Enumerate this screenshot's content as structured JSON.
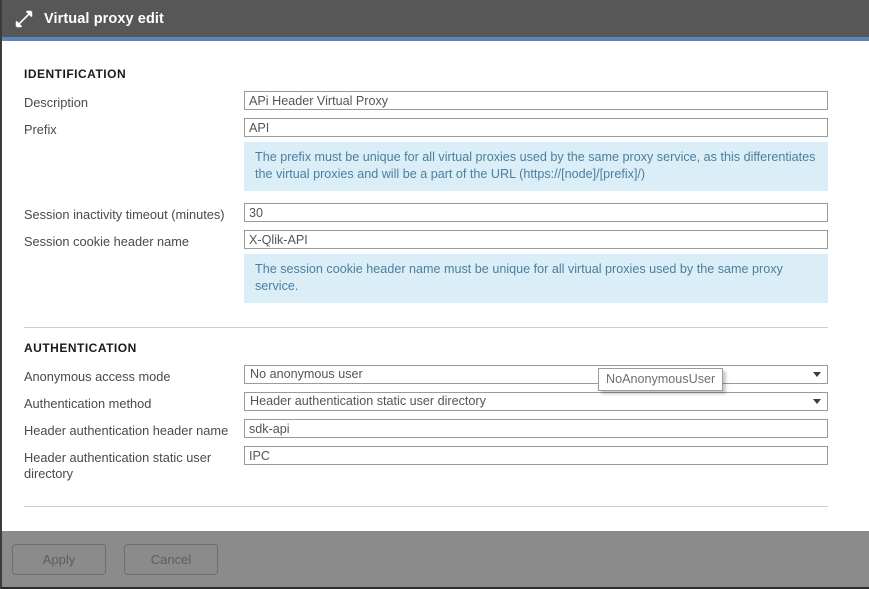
{
  "window": {
    "title": "Virtual proxy edit",
    "icon": "collapse-arrows-icon",
    "titlebar_color": "#575757",
    "accent_color": "#5b86b9"
  },
  "sections": {
    "identification": {
      "heading": "IDENTIFICATION",
      "fields": {
        "description": {
          "label": "Description",
          "value": "APi Header Virtual Proxy"
        },
        "prefix": {
          "label": "Prefix",
          "value": "API"
        },
        "prefix_info": "The prefix must be unique for all virtual proxies used by the same proxy service, as this differentiates the virtual proxies and will be a part of the URL (https://[node]/[prefix]/)",
        "session_timeout": {
          "label": "Session inactivity timeout (minutes)",
          "value": "30"
        },
        "session_cookie": {
          "label": "Session cookie header name",
          "value": "X-Qlik-API"
        },
        "session_cookie_info": "The session cookie header name must be unique for all virtual proxies used by the same proxy service."
      }
    },
    "authentication": {
      "heading": "AUTHENTICATION",
      "fields": {
        "anonymous_access_mode": {
          "label": "Anonymous access mode",
          "value": "No anonymous user"
        },
        "authentication_method": {
          "label": "Authentication method",
          "value": "Header authentication static user directory"
        },
        "header_name": {
          "label": "Header authentication header name",
          "value": "sdk-api"
        },
        "static_user_directory": {
          "label": "Header authentication static user directory",
          "value": "IPC"
        }
      }
    }
  },
  "tooltip": {
    "text": "NoAnonymousUser"
  },
  "footer": {
    "apply_label": "Apply",
    "cancel_label": "Cancel",
    "background": "#8b8b8b"
  }
}
